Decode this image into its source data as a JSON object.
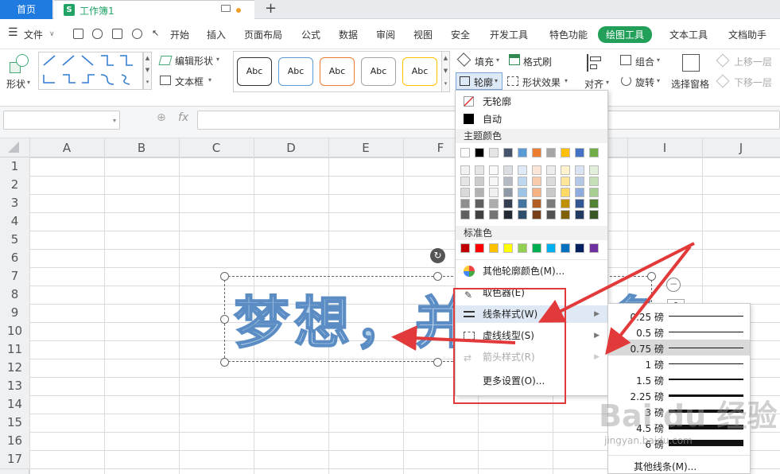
{
  "titlebar": {
    "home_tab": "首页",
    "workbook_tab": "工作簿1",
    "sheet_icon": "S",
    "new_tab": "+"
  },
  "menubar": {
    "file": "文件",
    "items": [
      "开始",
      "插入",
      "页面布局",
      "公式",
      "数据",
      "审阅",
      "视图",
      "安全",
      "开发工具",
      "特色功能",
      "绘图工具",
      "文本工具",
      "文档助手"
    ],
    "active": "绘图工具",
    "active_color": "#22a05a"
  },
  "ribbon": {
    "shape_label": "形状",
    "edit_shape": "编辑形状",
    "textbox": "文本框",
    "style_samples": [
      {
        "text": "Abc",
        "border": "#333333"
      },
      {
        "text": "Abc",
        "border": "#5b9bd5"
      },
      {
        "text": "Abc",
        "border": "#ed7d31"
      },
      {
        "text": "Abc",
        "border": "#a5a5a5"
      },
      {
        "text": "Abc",
        "border": "#ffc000"
      }
    ],
    "fill": "填充",
    "format_painter": "格式刷",
    "outline": "轮廓",
    "shape_effects": "形状效果",
    "align": "对齐",
    "group": "组合",
    "rotate": "旋转",
    "selection_pane": "选择窗格",
    "bring_forward": "上移一层",
    "send_backward": "下移一层"
  },
  "formula_bar": {
    "fx": "fx"
  },
  "grid": {
    "columns": [
      "A",
      "B",
      "C",
      "D",
      "E",
      "F",
      "G",
      "H",
      "I",
      "J"
    ],
    "rows": [
      "1",
      "2",
      "3",
      "4",
      "5",
      "6",
      "7",
      "8",
      "9",
      "10",
      "11",
      "12",
      "13",
      "14",
      "15",
      "16",
      "17"
    ]
  },
  "shape": {
    "text": "梦想，并",
    "text_tail": "多",
    "side_value": "0"
  },
  "outline_menu": {
    "no_outline": "无轮廓",
    "automatic": "自动",
    "theme_colors_title": "主题颜色",
    "theme_colors": [
      "#ffffff",
      "#000000",
      "#e7e6e6",
      "#44546a",
      "#5b9bd5",
      "#ed7d31",
      "#a5a5a5",
      "#ffc000",
      "#4472c4",
      "#70ad47"
    ],
    "standard_colors_title": "标准色",
    "standard_colors": [
      "#c00000",
      "#ff0000",
      "#ffc000",
      "#ffff00",
      "#92d050",
      "#00b050",
      "#00b0f0",
      "#0070c0",
      "#002060",
      "#7030a0"
    ],
    "more_colors": "其他轮廓颜色(M)...",
    "eyedropper": "取色器(E)",
    "line_style": "线条样式(W)",
    "dash_type": "虚线线型(S)",
    "arrow_style": "箭头样式(R)",
    "more_settings": "更多设置(O)..."
  },
  "weight_menu": {
    "items": [
      {
        "label": "0.25 磅",
        "weight": 0.25
      },
      {
        "label": "0.5 磅",
        "weight": 0.5
      },
      {
        "label": "0.75 磅",
        "weight": 0.75,
        "selected": true
      },
      {
        "label": "1 磅",
        "weight": 1
      },
      {
        "label": "1.5 磅",
        "weight": 1.5
      },
      {
        "label": "2.25 磅",
        "weight": 2.25
      },
      {
        "label": "3 磅",
        "weight": 3
      },
      {
        "label": "4.5 磅",
        "weight": 4.5
      },
      {
        "label": "6 磅",
        "weight": 6
      }
    ],
    "more_lines": "其他线条(M)..."
  },
  "annotation_color": "#e23a3a",
  "watermark": {
    "main": "Bai du 经验",
    "sub": "jingyan.baidu.com"
  }
}
